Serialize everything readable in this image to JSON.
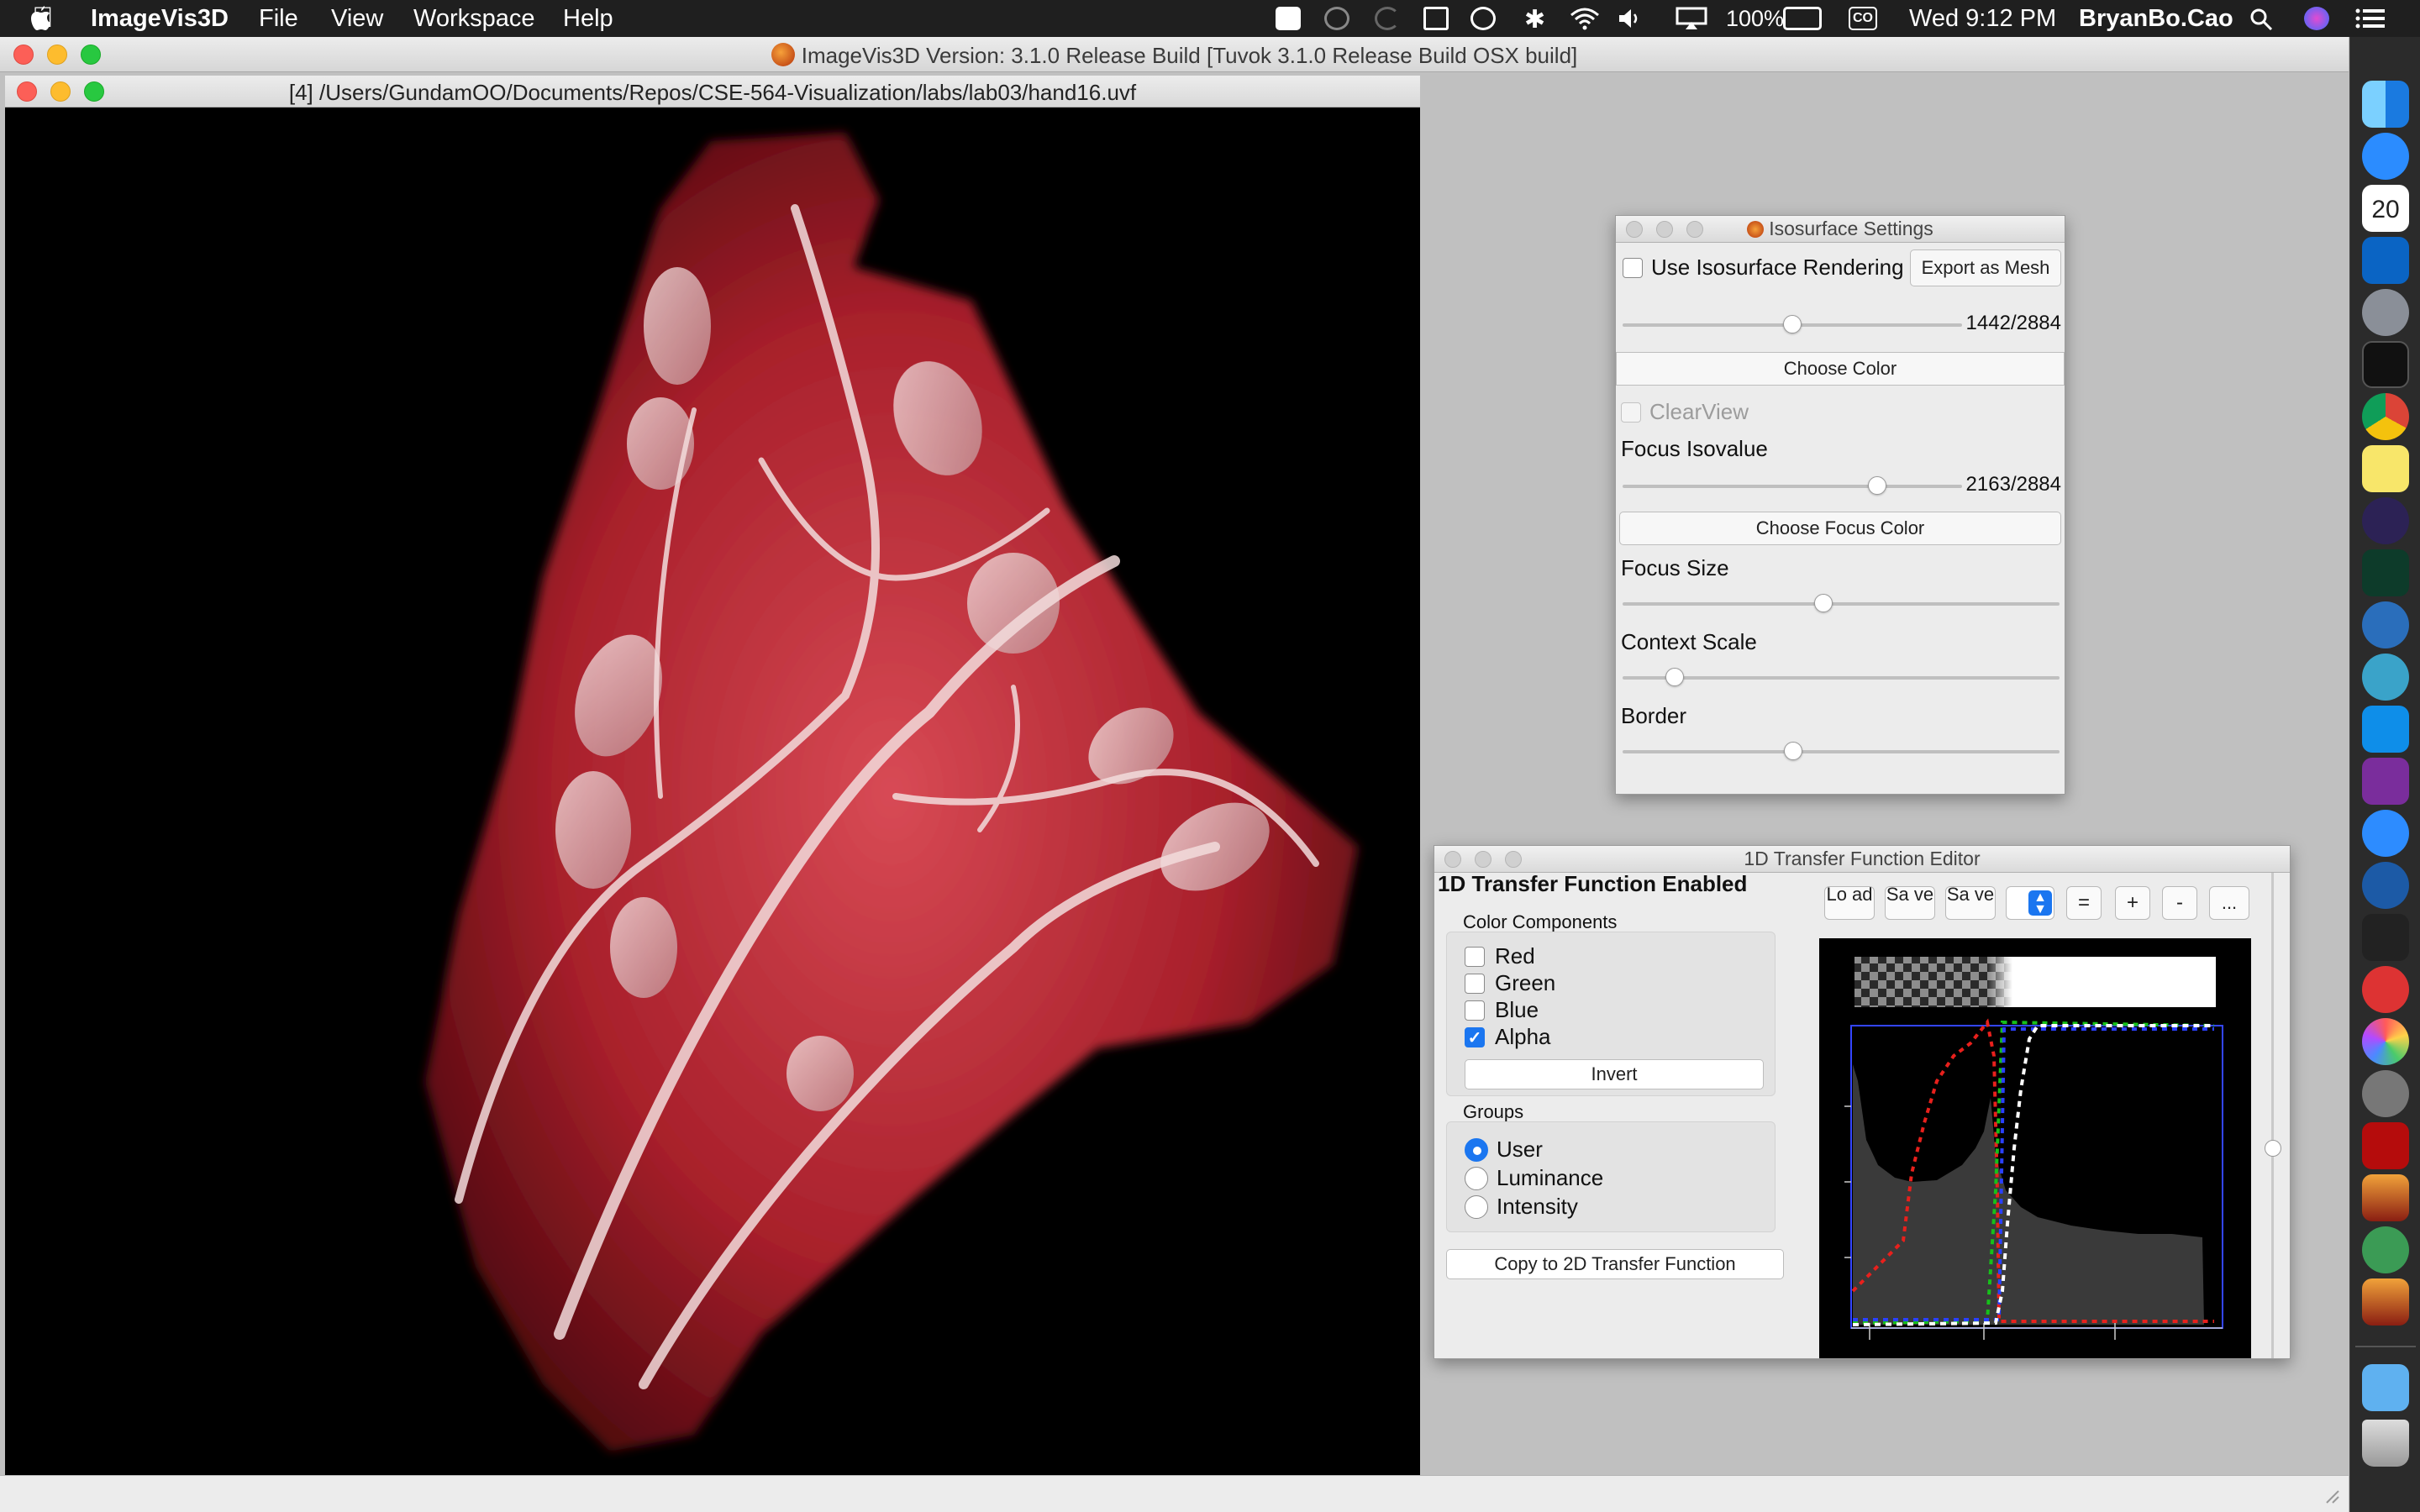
{
  "menubar": {
    "app_name": "ImageVis3D",
    "menus": [
      "File",
      "View",
      "Workspace",
      "Help"
    ],
    "battery": "100%",
    "clock": "Wed 9:12 PM",
    "user": "BryanBo.Cao",
    "input_badge": "CO",
    "status_icons": [
      "notes-icon",
      "creative-cloud-icon",
      "sync-icon",
      "screen-icon",
      "accessibility-icon",
      "bluetooth-icon",
      "wifi-icon",
      "volume-icon",
      "airplay-icon",
      "battery-icon",
      "search-icon",
      "siri-icon",
      "notification-center-icon"
    ]
  },
  "main_window": {
    "title": "ImageVis3D Version: 3.1.0 Release Build [Tuvok 3.1.0 Release Build OSX build]"
  },
  "render_window": {
    "title": "[4] /Users/GundamOO/Documents/Repos/CSE-564-Visualization/labs/lab03/hand16.uvf"
  },
  "iso_panel": {
    "title": "Isosurface Settings",
    "use_iso_label": "Use Isosurface Rendering",
    "use_iso_checked": false,
    "export_label": "Export as Mesh",
    "isovalue_text": "1442/2884",
    "isovalue": 0.5,
    "choose_color_label": "Choose Color",
    "clearview_label": "ClearView",
    "clearview_enabled": false,
    "focus_isovalue_label": "Focus Isovalue",
    "focus_isovalue_text": "2163/2884",
    "focus_isovalue": 0.75,
    "choose_focus_color_label": "Choose Focus Color",
    "focus_size_label": "Focus Size",
    "focus_size": 0.46,
    "context_scale_label": "Context Scale",
    "context_scale": 0.12,
    "border_label": "Border",
    "border": 0.39
  },
  "tf_panel": {
    "title": "1D Transfer Function Editor",
    "status": "1D Transfer Function Enabled",
    "color_components_label": "Color Components",
    "components": [
      {
        "label": "Red",
        "checked": false
      },
      {
        "label": "Green",
        "checked": false
      },
      {
        "label": "Blue",
        "checked": false
      },
      {
        "label": "Alpha",
        "checked": true
      }
    ],
    "invert_label": "Invert",
    "groups_label": "Groups",
    "groups": [
      {
        "label": "User",
        "selected": true
      },
      {
        "label": "Luminance",
        "selected": false
      },
      {
        "label": "Intensity",
        "selected": false
      }
    ],
    "copy_label": "Copy to 2D Transfer Function",
    "toolbar": {
      "load": "Lo ad",
      "save1": "Sa ve",
      "save2": "Sa ve",
      "equal": "=",
      "plus": "+",
      "minus": "-",
      "more": "..."
    },
    "colors": {
      "red": "#e8201c",
      "green": "#16c01a",
      "blue": "#2a40ff",
      "alpha": "#ffffff",
      "histogram": "#3a3a3a"
    }
  },
  "dock_apps": [
    "finder-icon",
    "pencil-app-icon",
    "calendar-icon",
    "outlook-icon",
    "launchpad-icon",
    "terminal-icon",
    "chrome-icon",
    "notes-app-icon",
    "eclipse-icon",
    "activity-monitor-icon",
    "r-app-icon",
    "scholar-icon",
    "teamviewer-icon",
    "onenote-icon",
    "zoom-icon",
    "quicktime-icon",
    "keynote-icon",
    "adobe-cc-icon",
    "color-icon",
    "system-preferences-icon",
    "acrobat-icon",
    "imagevis3d-icon-1",
    "atom-icon",
    "imagevis3d-icon-2",
    "downloads-folder-icon",
    "trash-icon"
  ],
  "calendar_date": "20"
}
